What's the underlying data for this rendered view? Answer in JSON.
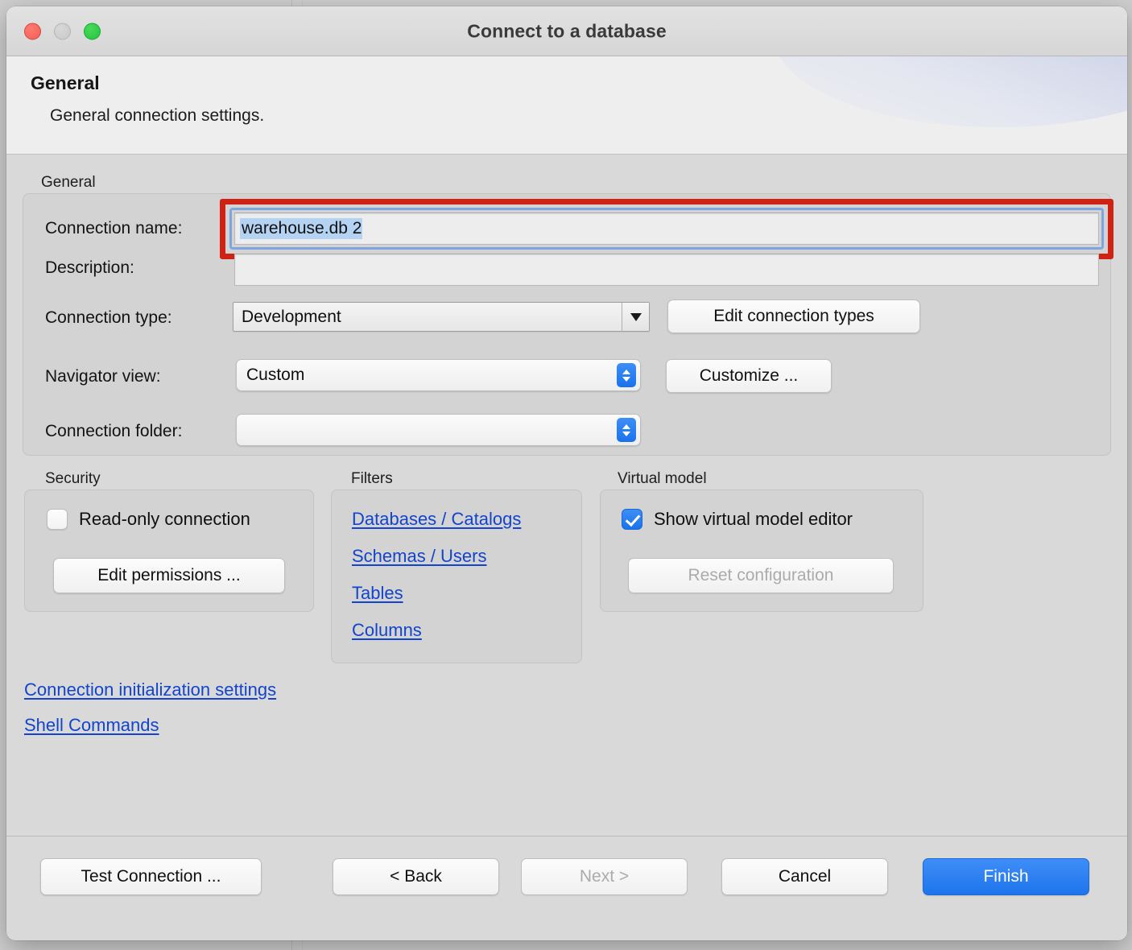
{
  "window": {
    "title": "Connect to a database",
    "traffic_lights": [
      "close",
      "minimize",
      "zoom"
    ]
  },
  "banner": {
    "title": "General",
    "subtitle": "General connection settings."
  },
  "general_group": {
    "legend": "General",
    "connection_name": {
      "label": "Connection name:",
      "value": "warehouse.db 2",
      "selected": true,
      "highlighted": true
    },
    "description": {
      "label": "Description:",
      "value": "",
      "placeholder": ""
    },
    "connection_type": {
      "label": "Connection type:",
      "value": "Development"
    },
    "edit_connection_types_button": "Edit connection types",
    "navigator_view": {
      "label": "Navigator view:",
      "value": "Custom"
    },
    "customize_button": "Customize ...",
    "connection_folder": {
      "label": "Connection folder:",
      "value": ""
    }
  },
  "security_group": {
    "legend": "Security",
    "read_only_checkbox": {
      "label": "Read-only connection",
      "checked": false
    },
    "edit_permissions_button": "Edit permissions ..."
  },
  "filters_group": {
    "legend": "Filters",
    "links": [
      "Databases / Catalogs",
      "Schemas / Users",
      "Tables",
      "Columns"
    ]
  },
  "virtual_model_group": {
    "legend": "Virtual model",
    "show_editor_checkbox": {
      "label": "Show virtual model editor",
      "checked": true
    },
    "reset_configuration_button": {
      "label": "Reset configuration",
      "enabled": false
    }
  },
  "bottom_links": [
    "Connection initialization settings",
    "Shell Commands"
  ],
  "footer": {
    "test_connection": "Test Connection ...",
    "back": "< Back",
    "next": "Next >",
    "next_enabled": false,
    "cancel": "Cancel",
    "finish": "Finish"
  },
  "colors": {
    "accent_blue": "#1a72eb",
    "link_blue": "#1344cc",
    "highlight_red": "#cf2114",
    "selection_blue": "#b4d2f2",
    "window_bg": "#d9d9d9"
  }
}
